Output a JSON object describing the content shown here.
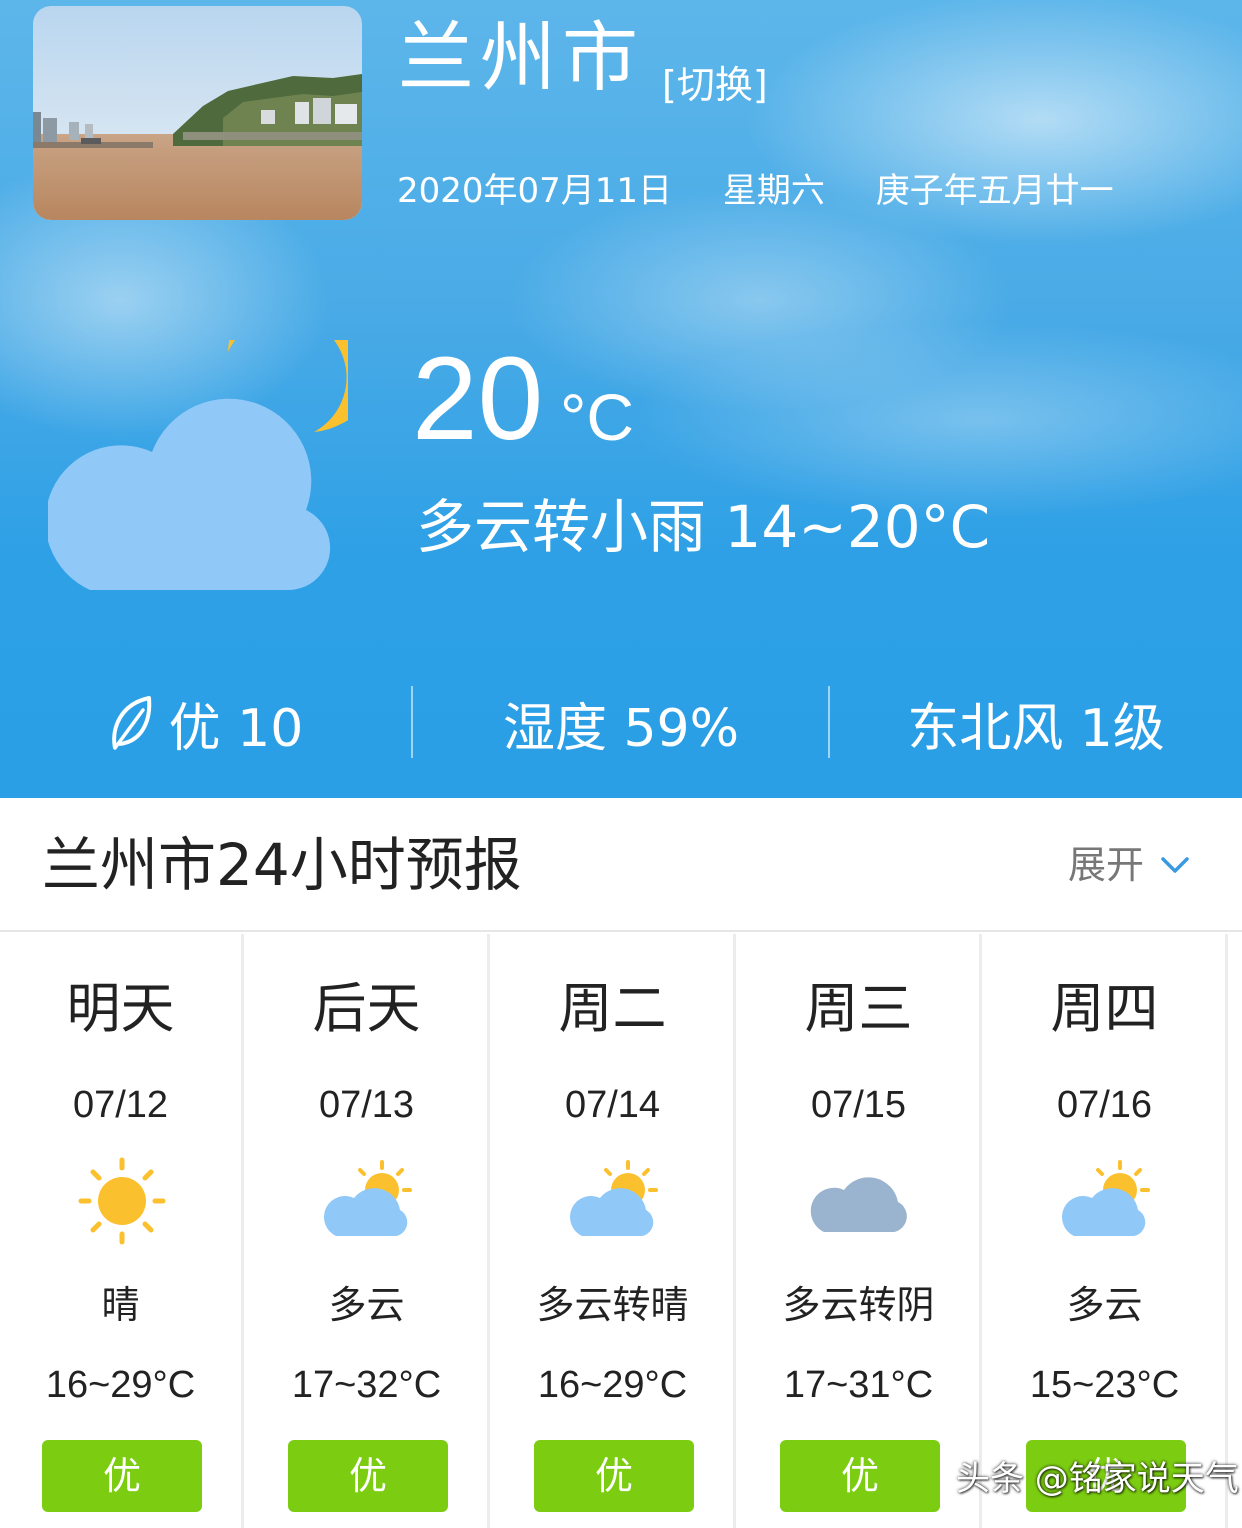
{
  "header": {
    "city": "兰州市",
    "switch_label": "[切换]",
    "date": "2020年07月11日",
    "weekday": "星期六",
    "lunar_date": "庚子年五月廿一"
  },
  "current": {
    "temperature": "20",
    "unit": "°C",
    "condition_summary": "多云转小雨 14~20°C",
    "icon": "moon-cloud-icon"
  },
  "stats": {
    "aqi": "优 10",
    "humidity": "湿度 59%",
    "wind": "东北风 1级"
  },
  "forecast": {
    "title": "兰州市24小时预报",
    "expand_label": "展开",
    "days": [
      {
        "name": "明天",
        "date": "07/12",
        "icon": "sun-icon",
        "condition": "晴",
        "range": "16~29°C",
        "aqi": "优"
      },
      {
        "name": "后天",
        "date": "07/13",
        "icon": "cloud-sun-icon",
        "condition": "多云",
        "range": "17~32°C",
        "aqi": "优"
      },
      {
        "name": "周二",
        "date": "07/14",
        "icon": "cloud-sun-icon",
        "condition": "多云转晴",
        "range": "16~29°C",
        "aqi": "优"
      },
      {
        "name": "周三",
        "date": "07/15",
        "icon": "overcast-cloud-icon",
        "condition": "多云转阴",
        "range": "17~31°C",
        "aqi": "优"
      },
      {
        "name": "周四",
        "date": "07/16",
        "icon": "cloud-sun-icon",
        "condition": "多云",
        "range": "15~23°C",
        "aqi": "优"
      }
    ]
  },
  "watermark": "头条 @铭家说天气",
  "colors": {
    "hero_blue": "#2a9fe6",
    "aqi_green": "#7ccd12",
    "sun_yellow": "#fbc02d",
    "cloud_blue": "#90c8f8",
    "overcast_gray": "#9ab3cf"
  }
}
